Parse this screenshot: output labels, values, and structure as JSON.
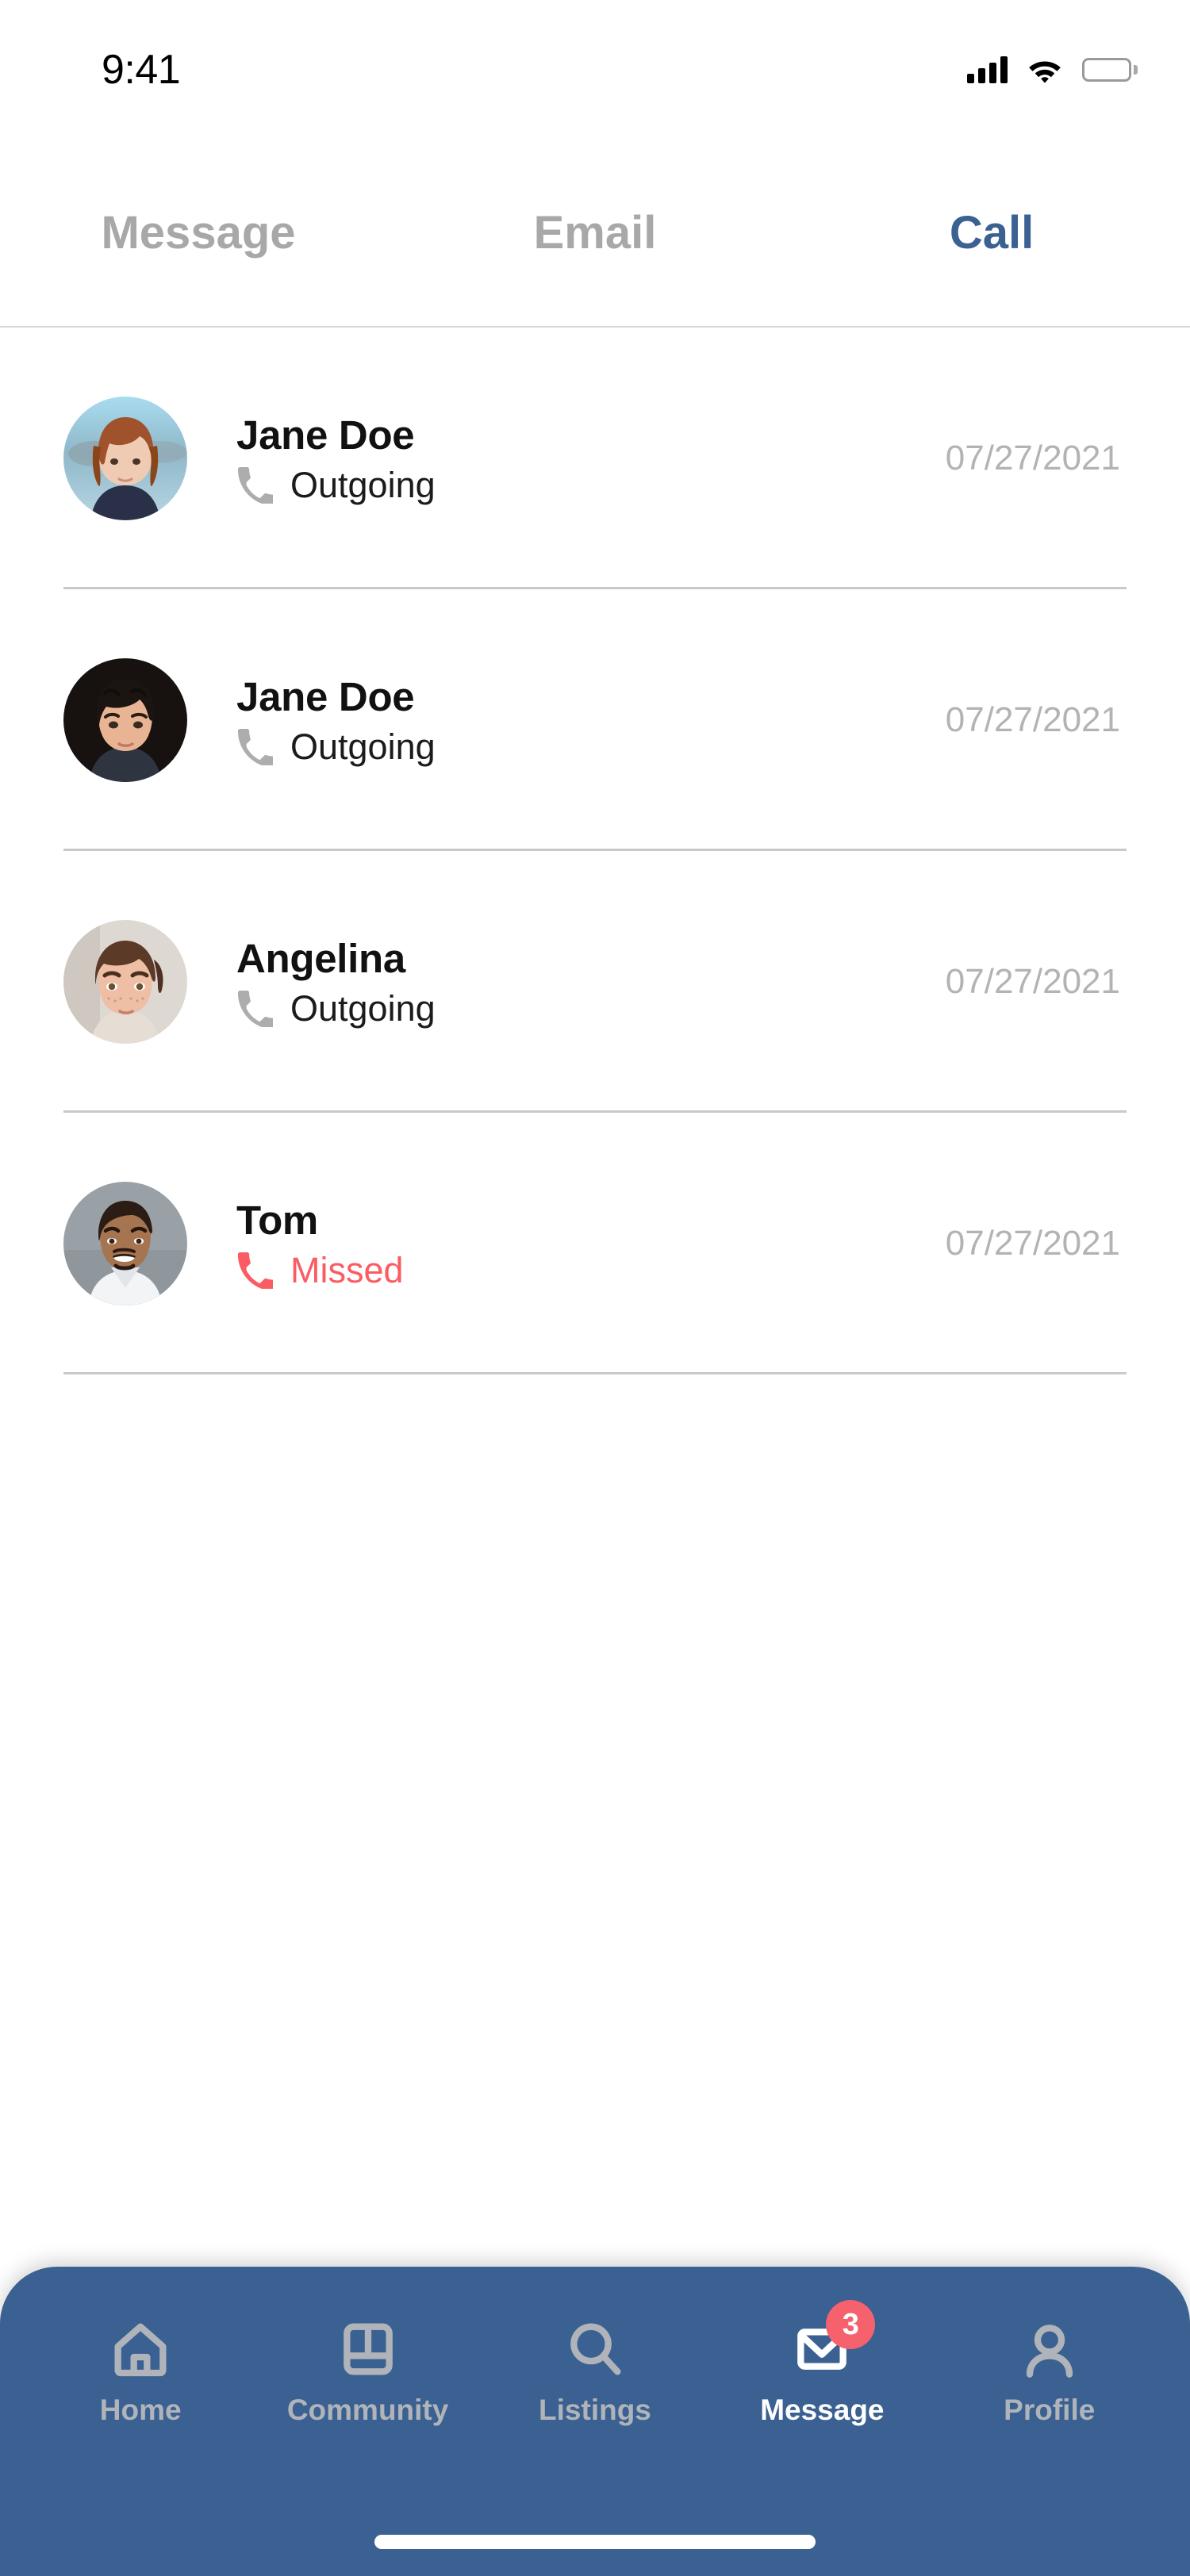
{
  "status_bar": {
    "time": "9:41",
    "signal_icon": "cellular-signal-icon",
    "wifi_icon": "wifi-icon",
    "battery_icon": "battery-full-icon"
  },
  "tabs": [
    {
      "label": "Message",
      "active": false
    },
    {
      "label": "Email",
      "active": false
    },
    {
      "label": "Call",
      "active": true
    }
  ],
  "call_list": [
    {
      "name": "Jane Doe",
      "status": "Outgoing",
      "status_type": "outgoing",
      "date": "07/27/2021",
      "avatar": "woman-red-hair-lake-background"
    },
    {
      "name": "Jane Doe",
      "status": "Outgoing",
      "status_type": "outgoing",
      "date": "07/27/2021",
      "avatar": "young-man-dark-curly-hair"
    },
    {
      "name": "Angelina",
      "status": "Outgoing",
      "status_type": "outgoing",
      "date": "07/27/2021",
      "avatar": "woman-freckles-brown-hair"
    },
    {
      "name": "Tom",
      "status": "Missed",
      "status_type": "missed",
      "date": "07/27/2021",
      "avatar": "smiling-man-grey-background"
    }
  ],
  "bottom_nav": [
    {
      "label": "Home",
      "icon": "home-icon",
      "active": false,
      "badge": null
    },
    {
      "label": "Community",
      "icon": "book-icon",
      "active": false,
      "badge": null
    },
    {
      "label": "Listings",
      "icon": "search-icon",
      "active": false,
      "badge": null
    },
    {
      "label": "Message",
      "icon": "envelope-icon",
      "active": true,
      "badge": "3"
    },
    {
      "label": "Profile",
      "icon": "person-icon",
      "active": false,
      "badge": null
    }
  ],
  "colors": {
    "accent_blue": "#3a6191",
    "nav_background": "#3a6191",
    "inactive_grey": "#a8a8a8",
    "nav_icon_grey": "#b0b4ba",
    "missed_red": "#fb5c63",
    "badge_red": "#f5616d",
    "date_grey": "#b3b3b3",
    "divider_grey": "#c9c9c9"
  },
  "home_indicator": "home-indicator-bar"
}
